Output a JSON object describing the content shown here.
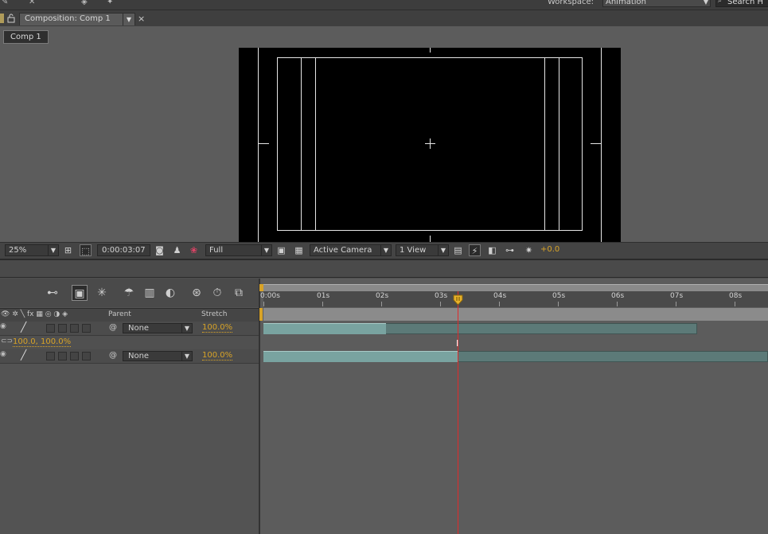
{
  "toolbar": {
    "workspace_label": "Workspace:",
    "workspace_value": "Animation",
    "search_placeholder": "Search H"
  },
  "composition_tab": {
    "title": "Composition: Comp 1",
    "breadcrumb": "Comp 1"
  },
  "viewer_controls": {
    "zoom": "25%",
    "timecode": "0:00:03:07",
    "resolution": "Full",
    "camera": "Active Camera",
    "views": "1 View",
    "exposure": "+0.0"
  },
  "timeline": {
    "columns": {
      "parent": "Parent",
      "stretch": "Stretch"
    },
    "ruler_labels": [
      "0:00s",
      "01s",
      "02s",
      "03s",
      "04s",
      "05s",
      "06s",
      "07s",
      "08s"
    ],
    "layers": [
      {
        "parent": "None",
        "stretch": "100.0%",
        "bar_start_s": 0.0,
        "bar_highlight_end_s": 2.08,
        "bar_end_s": 7.36
      },
      {
        "parent": "None",
        "stretch": "100.0%",
        "bar_start_s": 0.0,
        "bar_highlight_end_s": 3.3,
        "bar_end_s": 8.6
      }
    ],
    "scale_property_value": "100.0, 100.0%",
    "current_time_s": 3.3
  },
  "colors": {
    "accent": "#d8a327",
    "playhead": "#e02b2b",
    "layer_bar": "#79a3a0",
    "layer_bar_dim": "#5c7a78"
  }
}
